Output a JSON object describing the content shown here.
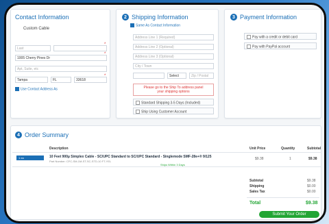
{
  "contact": {
    "title": "Contact Information",
    "name": "Custom Cable",
    "placeholder_first": "Last",
    "address": "1005 Cherry Pines Dr",
    "address2_placeholder": "Apt, Suite, etc",
    "city": "Tampa",
    "state": "FL",
    "zip": "33618",
    "same_address_label": "Use Contact Address As"
  },
  "shipping": {
    "step": "2",
    "title": "Shipping Information",
    "same_as_contact": "Same As Contact Information",
    "field1_placeholder": "Address Line 1 (Required)",
    "field2_placeholder": "Address Line 2 (Optional)",
    "field3_placeholder": "Address Line 3 (Optional)",
    "city_placeholder": "City / Town",
    "state_value": "Select",
    "zip_placeholder": "Zip / Postal",
    "warning_line1": "Please go to the Ship To address panel",
    "warning_line2": "your shipping options",
    "option1": "Standard Shipping 3-5 Days (Included)",
    "option2": "Ship Using Customer Account"
  },
  "payment": {
    "step": "3",
    "title": "Payment Information",
    "option1": "Pay with a credit or debit card",
    "option2": "Pay with PayPal account"
  },
  "summary": {
    "step": "4",
    "title": "Order Summary",
    "headers": {
      "description": "Description",
      "unit_price": "Unit Price",
      "quantity": "Quantity",
      "subtotal": "Subtotal"
    },
    "row": {
      "qty_badge": "1 ea",
      "description": "10 Feet 900µ Simplex Cable - SC/UPC Standard to SC/UPC Standard - Singlemode SMF-28e+® 9/125",
      "sub_description": "Part Number: CFC-SM-1M-ST-SC-STD-10 FT-YEL",
      "ships": "Ships Within 3 Days",
      "unit_price": "$9.38",
      "quantity": "1",
      "subtotal": "$9.38"
    },
    "totals": {
      "subtotal_label": "Subtotal",
      "subtotal_value": "$9.38",
      "shipping_label": "Shipping",
      "shipping_value": "$0.00",
      "tax_label": "Sales Tax",
      "tax_value": "$0.00",
      "total_label": "Total",
      "total_value": "$9.38"
    },
    "submit_label": "Submit Your Order"
  },
  "colors": {
    "accent": "#1b6fb6",
    "success": "#22a534",
    "warning": "#d33333"
  }
}
